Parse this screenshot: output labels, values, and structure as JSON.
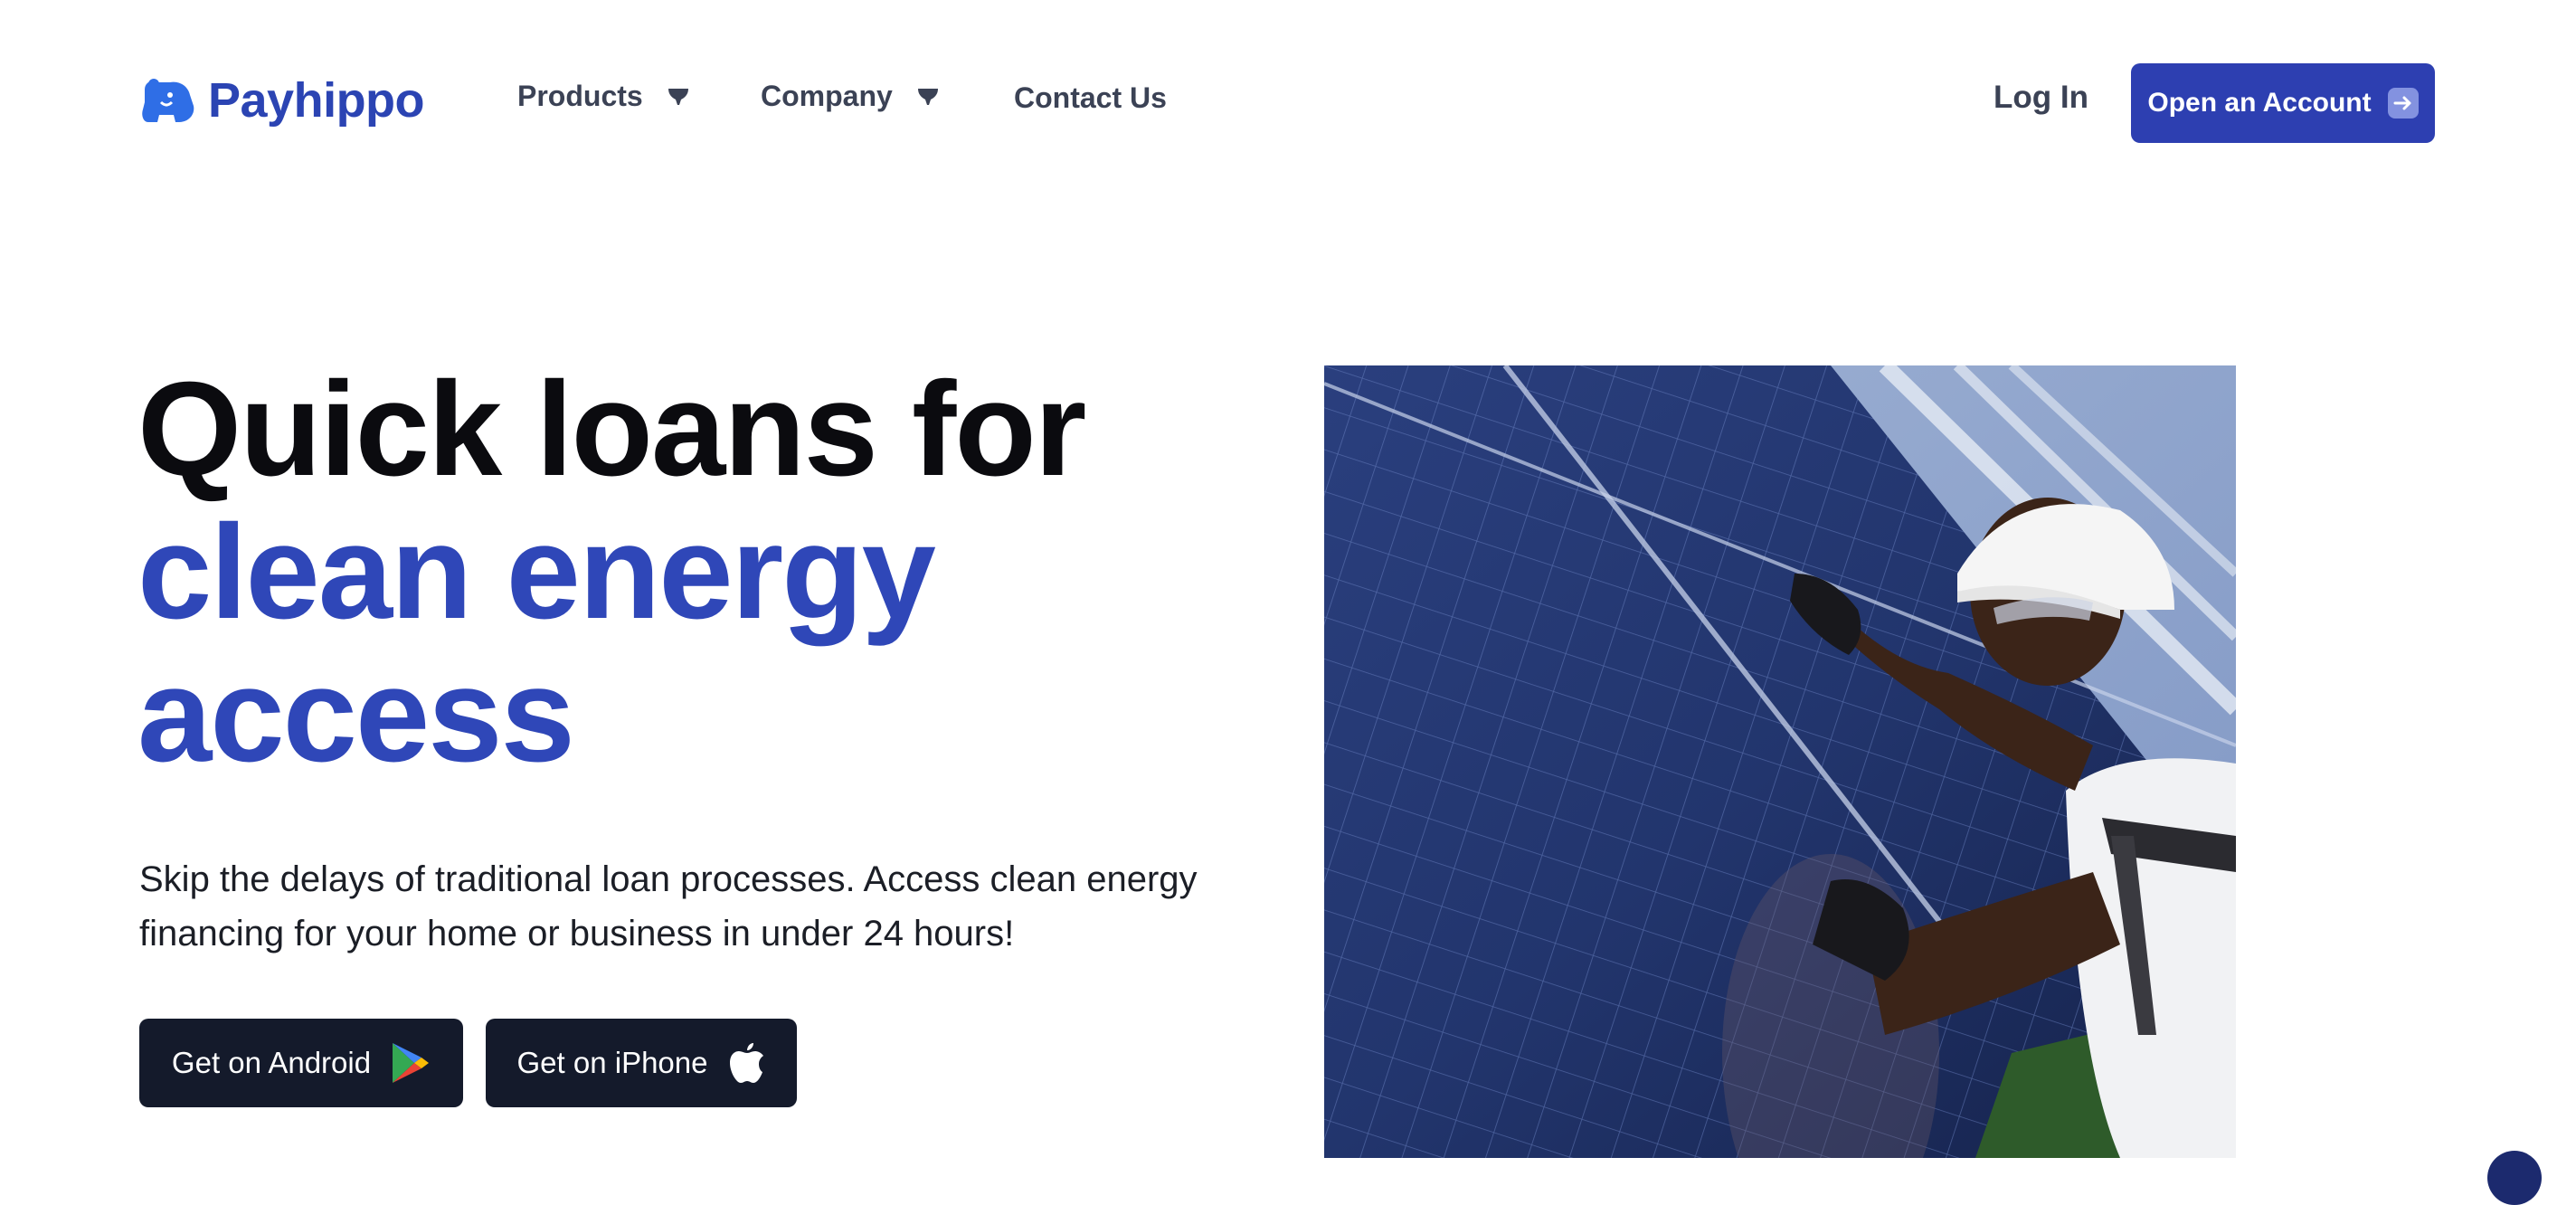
{
  "brand": {
    "name": "Payhippo",
    "color": "#2b44b3"
  },
  "nav": {
    "items": [
      {
        "label": "Products",
        "has_dropdown": true
      },
      {
        "label": "Company",
        "has_dropdown": true
      },
      {
        "label": "Contact Us",
        "has_dropdown": false
      }
    ],
    "login_label": "Log In",
    "cta_label": "Open an Account"
  },
  "hero": {
    "title_line1": "Quick loans for",
    "title_line2": "clean energy",
    "title_line3": "access",
    "subtitle": "Skip the delays of traditional loan processes. Access clean energy financing for your home or business in under 24 hours!",
    "android_button": "Get on Android",
    "iphone_button": "Get on iPhone"
  },
  "colors": {
    "accent": "#2f47b8",
    "cta_bg": "#2d3fb1",
    "store_bg": "#141a2b",
    "heading": "#0b0b0f"
  },
  "icons": [
    "hippo-logo-icon",
    "chevron-down-icon",
    "arrow-right-icon",
    "google-play-icon",
    "apple-icon"
  ]
}
